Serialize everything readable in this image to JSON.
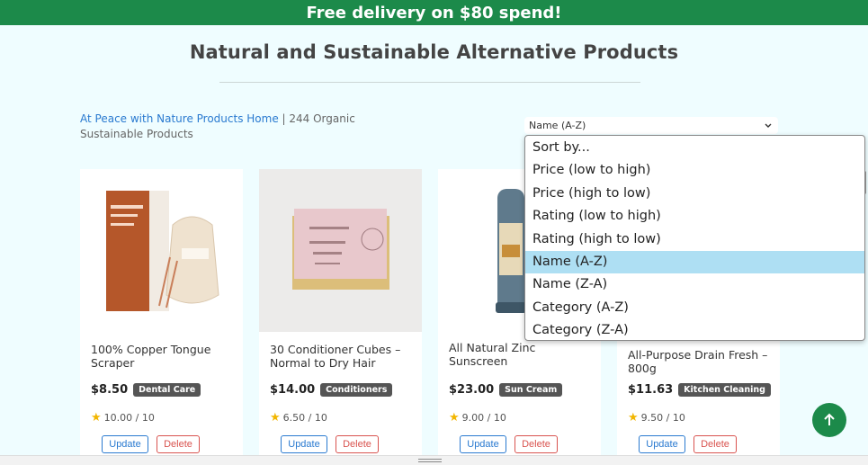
{
  "banner": {
    "text": "Free delivery on $80 spend!"
  },
  "page": {
    "title": "Natural and Sustainable Alternative Products"
  },
  "breadcrumb": {
    "home_link": "At Peace with Nature Products Home",
    "separator": " | ",
    "count_text": "244 Organic Sustainable Products"
  },
  "sort": {
    "selected": "Name (A-Z)",
    "options": [
      "Sort by...",
      "Price (low to high)",
      "Price (high to low)",
      "Rating (low to high)",
      "Rating (high to low)",
      "Name (A-Z)",
      "Name (Z-A)",
      "Category (A-Z)",
      "Category (Z-A)"
    ]
  },
  "products": [
    {
      "name": "100% Copper Tongue Scraper",
      "price": "$8.50",
      "category": "Dental Care",
      "rating": "10.00 / 10",
      "image_icon": "tongue-scraper-product-image"
    },
    {
      "name": "30 Conditioner Cubes – Normal to Dry Hair",
      "price": "$14.00",
      "category": "Conditioners",
      "rating": "6.50 / 10",
      "image_icon": "conditioner-bar-product-image"
    },
    {
      "name": "All Natural Zinc Sunscreen",
      "price": "$23.00",
      "category": "Sun Cream",
      "rating": "9.00 / 10",
      "image_icon": "sunscreen-tube-product-image"
    },
    {
      "name": "All-Purpose Drain Fresh – 800g",
      "price": "$11.63",
      "category": "Kitchen Cleaning",
      "rating": "9.50 / 10",
      "image_icon": "drain-fresh-product-image"
    }
  ],
  "actions": {
    "update_label": "Update",
    "delete_label": "Delete"
  },
  "colors": {
    "brand_green": "#1c8a4a",
    "link_blue": "#2a7ad0",
    "delete_red": "#d9534f",
    "selected_option": "#aedff3"
  }
}
